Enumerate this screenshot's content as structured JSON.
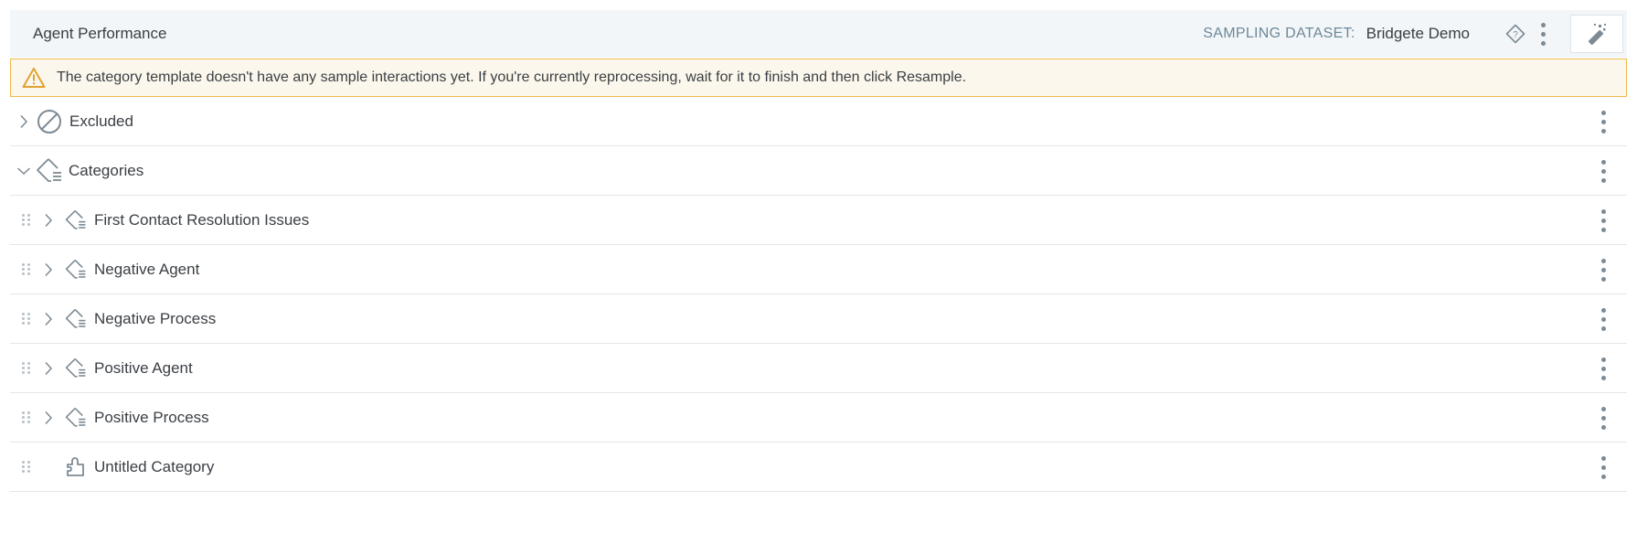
{
  "header": {
    "title": "Agent Performance",
    "dataset_label": "SAMPLING DATASET:",
    "dataset_value": "Bridgete Demo",
    "icons": [
      "tag-help-icon",
      "more-vertical-icon",
      "magic-wand-icon"
    ]
  },
  "warning": {
    "text": "The category template doesn't have any sample interactions yet. If you're currently reprocessing, wait for it to finish and then click Resample.",
    "color": "#f0b94a",
    "icon": "warning-triangle-icon"
  },
  "tree": {
    "excluded": {
      "label": "Excluded",
      "expanded": false,
      "icon": "prohibited-icon"
    },
    "categories": {
      "label": "Categories",
      "expanded": true,
      "icon": "category-tag-icon"
    },
    "children": [
      {
        "label": "First Contact Resolution Issues",
        "icon": "category-tag-icon",
        "expandable": true
      },
      {
        "label": "Negative Agent",
        "icon": "category-tag-icon",
        "expandable": true
      },
      {
        "label": "Negative Process",
        "icon": "category-tag-icon",
        "expandable": true
      },
      {
        "label": "Positive Agent",
        "icon": "category-tag-icon",
        "expandable": true
      },
      {
        "label": "Positive Process",
        "icon": "category-tag-icon",
        "expandable": true
      },
      {
        "label": "Untitled Category",
        "icon": "puzzle-piece-icon",
        "expandable": false
      }
    ]
  },
  "colors": {
    "header_bg": "#f2f6f9",
    "warning_bg": "#fcf7ec",
    "icon_gray": "#7d8a94",
    "divider": "#e3e7ea"
  }
}
